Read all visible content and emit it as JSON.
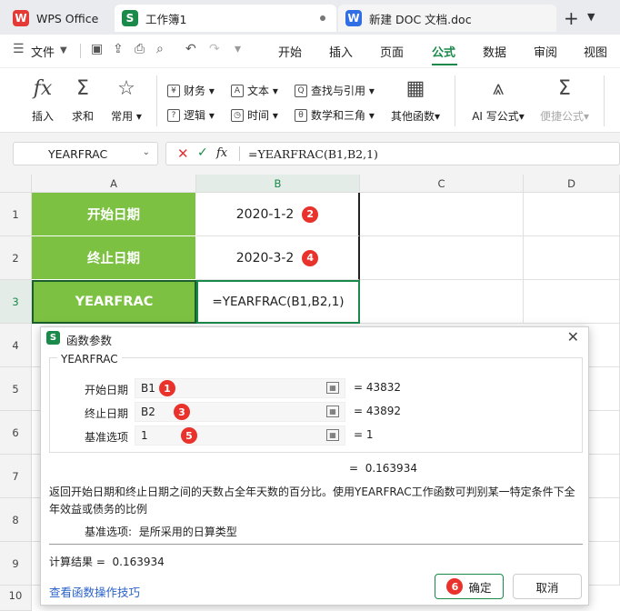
{
  "tabs": [
    {
      "label": "WPS Office",
      "icon": "wps-logo-icon"
    },
    {
      "label": "工作簿1",
      "icon": "sheet-icon",
      "modified": true
    },
    {
      "label": "新建 DOC 文档.doc",
      "icon": "doc-icon"
    }
  ],
  "menu": {
    "file": "文件",
    "items": [
      "开始",
      "插入",
      "页面",
      "公式",
      "数据",
      "审阅",
      "视图"
    ],
    "active": "公式"
  },
  "ribbon": {
    "insert": "插入",
    "autosum": "求和",
    "common": "常用",
    "finance": "财务",
    "text": "文本",
    "lookup": "查找与引用",
    "other": "其他函数",
    "logic": "逻辑",
    "time": "时间",
    "math": "数学和三角",
    "ai": "AI 写公式",
    "quick": "便捷公式"
  },
  "formula_bar": {
    "name_box": "YEARFRAC",
    "formula": "=YEARFRAC(B1,B2,1)"
  },
  "grid": {
    "columns": [
      "A",
      "B",
      "C",
      "D"
    ],
    "rows": [
      "1",
      "2",
      "3",
      "4",
      "5",
      "6",
      "7",
      "8",
      "9",
      "10"
    ],
    "a1": "开始日期",
    "b1": "2020-1-2",
    "a2": "终止日期",
    "b2": "2020-3-2",
    "a3": "YEARFRAC",
    "b3": "=YEARFRAC(B1,B2,1)"
  },
  "dialog": {
    "title": "函数参数",
    "function_name": "YEARFRAC",
    "params": [
      {
        "label": "开始日期",
        "value": "B1",
        "result": "43832",
        "badge": "1"
      },
      {
        "label": "终止日期",
        "value": "B2",
        "result": "43892",
        "badge": "3"
      },
      {
        "label": "基准选项",
        "value": "1",
        "result": "1",
        "badge": "5"
      }
    ],
    "eq": "=",
    "formula_result": "0.163934",
    "description": "返回开始日期和终止日期之间的天数占全年天数的百分比。使用YEARFRAC工作函数可判别某一特定条件下全年效益或债务的比例",
    "param_desc_label": "基准选项:",
    "param_desc": "是所采用的日算类型",
    "calc_label": "计算结果 =",
    "calc_value": "0.163934",
    "help_link": "查看函数操作技巧",
    "ok": "确定",
    "cancel": "取消",
    "ok_badge": "6"
  },
  "cell_badges": {
    "b1": "2",
    "b2": "4"
  },
  "colors": {
    "accent_green": "#7dc143",
    "badge_red": "#e8322b",
    "brand_green": "#1a8a4a"
  }
}
